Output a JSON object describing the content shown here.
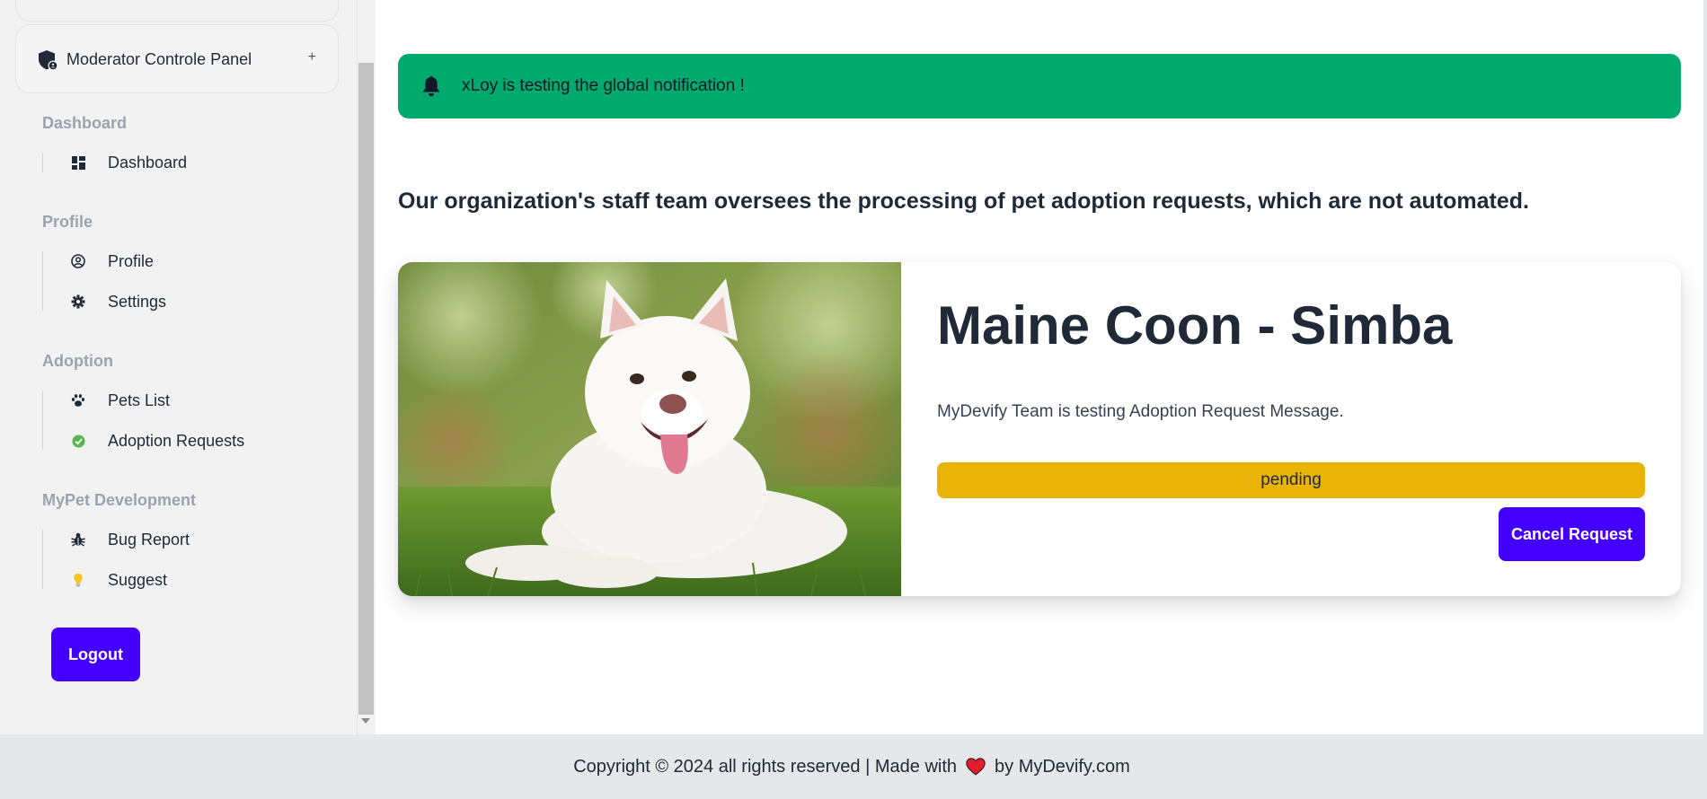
{
  "sidebar": {
    "panel_title": "Moderator Controle Panel",
    "panel_toggle": "+",
    "sections": [
      {
        "title": "Dashboard",
        "items": [
          {
            "label": "Dashboard",
            "icon": "dashboard-icon"
          }
        ]
      },
      {
        "title": "Profile",
        "items": [
          {
            "label": "Profile",
            "icon": "user-circle-icon"
          },
          {
            "label": "Settings",
            "icon": "gear-icon"
          }
        ]
      },
      {
        "title": "Adoption",
        "items": [
          {
            "label": "Pets List",
            "icon": "paw-icon"
          },
          {
            "label": "Adoption Requests",
            "icon": "check-circle-icon"
          }
        ]
      },
      {
        "title": "MyPet Development",
        "items": [
          {
            "label": "Bug Report",
            "icon": "bug-icon"
          },
          {
            "label": "Suggest",
            "icon": "lightbulb-icon"
          }
        ]
      }
    ],
    "logout_label": "Logout"
  },
  "notification": {
    "icon": "bell-icon",
    "message": "xLoy is testing the global notification !",
    "color": "#00a96e"
  },
  "main": {
    "intro": "Our organization's staff team oversees the processing of pet adoption requests, which are not automated."
  },
  "pet": {
    "name": "Maine Coon - Simba",
    "message": "MyDevify Team is testing Adoption Request Message.",
    "status": "pending",
    "status_color": "#eab308",
    "cancel_label": "Cancel Request",
    "photo": "white-dog-photo"
  },
  "footer": {
    "text_before": "Copyright © 2024 all rights reserved | Made with",
    "icon": "heart-icon",
    "text_after": "by MyDevify.com"
  },
  "colors": {
    "accent": "#4400ff",
    "sidebar_bg": "#f2f2f3",
    "footer_bg": "#e5e7e8"
  }
}
